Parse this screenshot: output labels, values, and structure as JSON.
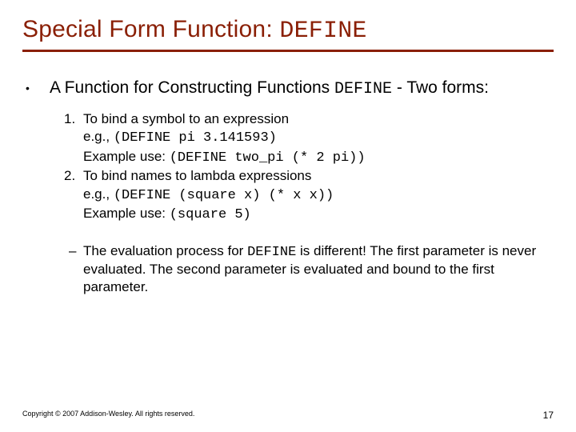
{
  "title": {
    "prefix": "Special Form Function: ",
    "code": "DEFINE"
  },
  "lead": {
    "part1": "A Function for Constructing Functions ",
    "code": "DEFINE",
    "part2": " - Two forms:"
  },
  "items": [
    {
      "num": "1.",
      "line1": "To bind a symbol to an expression",
      "line2a": "e.g., ",
      "line2code": "(DEFINE pi 3.141593)",
      "line3a": "Example use: ",
      "line3code": "(DEFINE two_pi (* 2 pi))"
    },
    {
      "num": "2.",
      "line1": "To bind names to lambda expressions",
      "line2a": "e.g., ",
      "line2code": "(DEFINE (square x) (* x x))",
      "line3a": "Example use: ",
      "line3code": "(square 5)"
    }
  ],
  "sub": {
    "dash": "–",
    "text1": "The evaluation process for ",
    "code": "DEFINE",
    "text2": " is different! The first parameter is never evaluated. The second parameter is evaluated and bound to the first parameter."
  },
  "footer": {
    "copyright": "Copyright © 2007 Addison-Wesley. All rights reserved.",
    "page": "17"
  }
}
